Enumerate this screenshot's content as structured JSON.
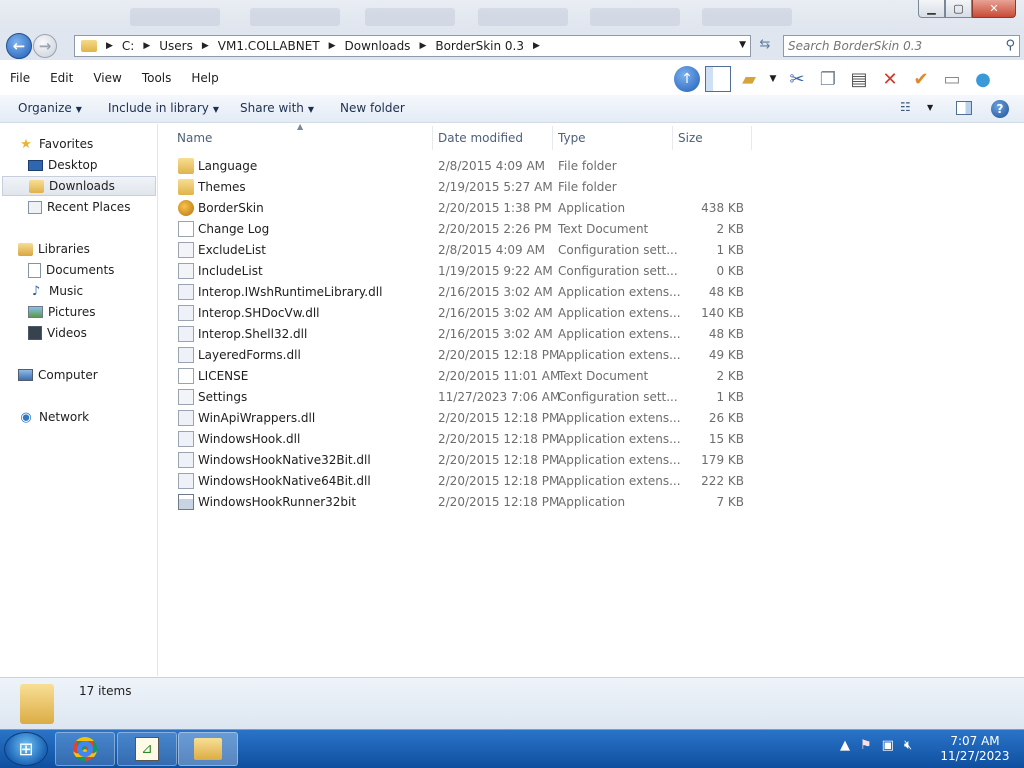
{
  "window": {
    "min_label": "▁",
    "max_label": "▢",
    "close_label": "✕"
  },
  "address": {
    "crumbs": [
      "C:",
      "Users",
      "VM1.COLLABNET",
      "Downloads",
      "BorderSkin 0.3"
    ]
  },
  "search": {
    "placeholder": "Search BorderSkin 0.3"
  },
  "menu": [
    "File",
    "Edit",
    "View",
    "Tools",
    "Help"
  ],
  "commands": {
    "organize": "Organize",
    "include_in_library": "Include in library",
    "share_with": "Share with",
    "new_folder": "New folder"
  },
  "nav": {
    "favorites": "Favorites",
    "desktop": "Desktop",
    "downloads": "Downloads",
    "recent_places": "Recent Places",
    "libraries": "Libraries",
    "documents": "Documents",
    "music": "Music",
    "pictures": "Pictures",
    "videos": "Videos",
    "computer": "Computer",
    "network": "Network"
  },
  "columns": {
    "name": "Name",
    "date_modified": "Date modified",
    "type": "Type",
    "size": "Size"
  },
  "files": [
    {
      "name": "Language",
      "date": "2/8/2015 4:09 AM",
      "type": "File folder",
      "size": "",
      "icon": "folder"
    },
    {
      "name": "Themes",
      "date": "2/19/2015 5:27 AM",
      "type": "File folder",
      "size": "",
      "icon": "folder"
    },
    {
      "name": "BorderSkin",
      "date": "2/20/2015 1:38 PM",
      "type": "Application",
      "size": "438 KB",
      "icon": "app"
    },
    {
      "name": "Change Log",
      "date": "2/20/2015 2:26 PM",
      "type": "Text Document",
      "size": "2 KB",
      "icon": "txt"
    },
    {
      "name": "ExcludeList",
      "date": "2/8/2015 4:09 AM",
      "type": "Configuration sett...",
      "size": "1 KB",
      "icon": "cfg"
    },
    {
      "name": "IncludeList",
      "date": "1/19/2015 9:22 AM",
      "type": "Configuration sett...",
      "size": "0 KB",
      "icon": "cfg"
    },
    {
      "name": "Interop.IWshRuntimeLibrary.dll",
      "date": "2/16/2015 3:02 AM",
      "type": "Application extens...",
      "size": "48 KB",
      "icon": "dll"
    },
    {
      "name": "Interop.SHDocVw.dll",
      "date": "2/16/2015 3:02 AM",
      "type": "Application extens...",
      "size": "140 KB",
      "icon": "dll"
    },
    {
      "name": "Interop.Shell32.dll",
      "date": "2/16/2015 3:02 AM",
      "type": "Application extens...",
      "size": "48 KB",
      "icon": "dll"
    },
    {
      "name": "LayeredForms.dll",
      "date": "2/20/2015 12:18 PM",
      "type": "Application extens...",
      "size": "49 KB",
      "icon": "dll"
    },
    {
      "name": "LICENSE",
      "date": "2/20/2015 11:01 AM",
      "type": "Text Document",
      "size": "2 KB",
      "icon": "txt"
    },
    {
      "name": "Settings",
      "date": "11/27/2023 7:06 AM",
      "type": "Configuration sett...",
      "size": "1 KB",
      "icon": "cfg"
    },
    {
      "name": "WinApiWrappers.dll",
      "date": "2/20/2015 12:18 PM",
      "type": "Application extens...",
      "size": "26 KB",
      "icon": "dll"
    },
    {
      "name": "WindowsHook.dll",
      "date": "2/20/2015 12:18 PM",
      "type": "Application extens...",
      "size": "15 KB",
      "icon": "dll"
    },
    {
      "name": "WindowsHookNative32Bit.dll",
      "date": "2/20/2015 12:18 PM",
      "type": "Application extens...",
      "size": "179 KB",
      "icon": "dll"
    },
    {
      "name": "WindowsHookNative64Bit.dll",
      "date": "2/20/2015 12:18 PM",
      "type": "Application extens...",
      "size": "222 KB",
      "icon": "dll"
    },
    {
      "name": "WindowsHookRunner32bit",
      "date": "2/20/2015 12:18 PM",
      "type": "Application",
      "size": "7 KB",
      "icon": "exe"
    }
  ],
  "status": {
    "item_count": "17 items"
  },
  "clock": {
    "time": "7:07 AM",
    "date": "11/27/2023"
  }
}
